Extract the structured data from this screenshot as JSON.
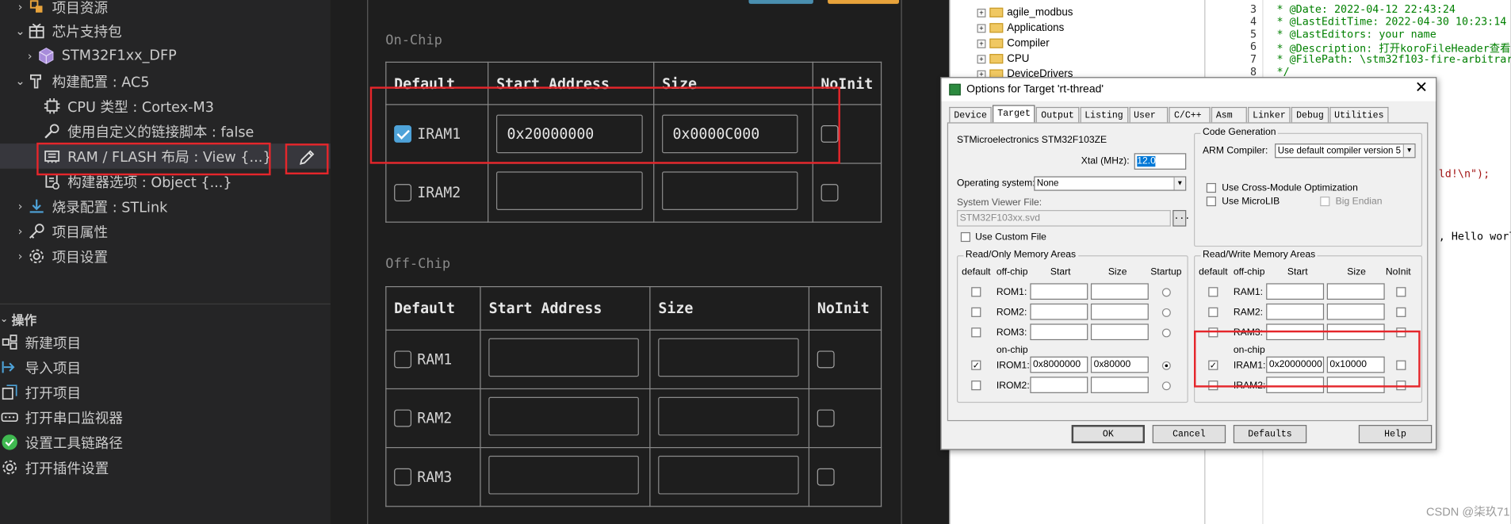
{
  "sidebar": {
    "tree": [
      {
        "label": "项目资源",
        "icon": "resource-icon",
        "chevron": "›"
      },
      {
        "label": "芯片支持包",
        "icon": "package-icon",
        "chevron": "⌄"
      },
      {
        "label": "STM32F1xx_DFP",
        "icon": "cube-icon",
        "chevron": "›"
      },
      {
        "label": "构建配置 : AC5",
        "icon": "hammer-icon",
        "chevron": "⌄"
      },
      {
        "label": "CPU 类型 : Cortex-M3",
        "icon": "cpu-icon",
        "chevron": ""
      },
      {
        "label": "使用自定义的链接脚本 : false",
        "icon": "wrench-icon",
        "chevron": ""
      },
      {
        "label": "RAM / FLASH 布局 : View {...}",
        "icon": "memory-icon",
        "chevron": ""
      },
      {
        "label": "构建器选项 : Object {...}",
        "icon": "builder-options-icon",
        "chevron": ""
      },
      {
        "label": "烧录配置 : STLink",
        "icon": "download-icon",
        "chevron": "›"
      },
      {
        "label": "项目属性",
        "icon": "key-icon",
        "chevron": "›"
      },
      {
        "label": "项目设置",
        "icon": "gear-icon",
        "chevron": "›"
      }
    ],
    "section_title": "操作",
    "actions": [
      {
        "label": "新建项目",
        "icon": "new-project-icon"
      },
      {
        "label": "导入项目",
        "icon": "import-icon"
      },
      {
        "label": "打开项目",
        "icon": "open-project-icon"
      },
      {
        "label": "打开串口监视器",
        "icon": "serial-icon"
      },
      {
        "label": "设置工具链路径",
        "icon": "check-circle-icon"
      },
      {
        "label": "打开插件设置",
        "icon": "plugin-gear-icon"
      }
    ]
  },
  "memview": {
    "on_chip_title": "On-Chip",
    "off_chip_title": "Off-Chip",
    "headers": [
      "Default",
      "Start Address",
      "Size",
      "NoInit"
    ],
    "on_chip_rows": [
      {
        "name": "IRAM1",
        "checked": true,
        "start": "0x20000000",
        "size": "0x0000C000"
      },
      {
        "name": "IRAM2",
        "checked": false,
        "start": "",
        "size": ""
      }
    ],
    "off_chip_rows": [
      {
        "name": "RAM1",
        "checked": false,
        "start": "",
        "size": ""
      },
      {
        "name": "RAM2",
        "checked": false,
        "start": "",
        "size": ""
      },
      {
        "name": "RAM3",
        "checked": false,
        "start": "",
        "size": ""
      }
    ]
  },
  "explorer": {
    "items": [
      "agile_modbus",
      "Applications",
      "Compiler",
      "CPU",
      "DeviceDrivers"
    ]
  },
  "editor": {
    "lines": [
      {
        "n": "3",
        "text": " * @Date: 2022-04-12 22:43:24",
        "kind": "cmt"
      },
      {
        "n": "4",
        "text": " * @LastEditTime: 2022-04-30 10:23:14",
        "kind": "cmt"
      },
      {
        "n": "5",
        "text": " * @LastEditors: your name",
        "kind": "cmt"
      },
      {
        "n": "6",
        "text": " * @Description: 打开koroFileHeader查看",
        "kind": "cmt"
      },
      {
        "n": "7",
        "text": " * @FilePath: \\stm32f103-fire-arbitrar",
        "kind": "cmt"
      },
      {
        "n": "8",
        "text": " */",
        "kind": "cmt"
      }
    ],
    "fragment1": "ld!\\n\");",
    "fragment2": ", Hello worl",
    "watermark": "CSDN @柒玖71"
  },
  "dialog": {
    "title": "Options for Target 'rt-thread'",
    "tabs": [
      "Device",
      "Target",
      "Output",
      "Listing",
      "User",
      "C/C++",
      "Asm",
      "Linker",
      "Debug",
      "Utilities"
    ],
    "active_tab": "Target",
    "device_name": "STMicroelectronics STM32F103ZE",
    "xtal_label": "Xtal (MHz):",
    "xtal_value": "12.0",
    "os_label": "Operating system:",
    "os_value": "None",
    "svf_label": "System Viewer File:",
    "svf_value": "STM32F103xx.svd",
    "custom_file": "Use Custom File",
    "codegen_title": "Code Generation",
    "arm_compiler_label": "ARM Compiler:",
    "arm_compiler_value": "Use default compiler version 5",
    "cross_module": "Use Cross-Module Optimization",
    "microlib": "Use MicroLIB",
    "big_endian": "Big Endian",
    "ro_title": "Read/Only Memory Areas",
    "rw_title": "Read/Write Memory Areas",
    "ro_headers": [
      "default",
      "off-chip",
      "Start",
      "Size",
      "Startup"
    ],
    "rw_headers": [
      "default",
      "off-chip",
      "Start",
      "Size",
      "NoInit"
    ],
    "on_chip_label": "on-chip",
    "ro_rows": [
      {
        "name": "ROM1:",
        "start": "",
        "size": "",
        "def": false,
        "startup": false
      },
      {
        "name": "ROM2:",
        "start": "",
        "size": "",
        "def": false,
        "startup": false
      },
      {
        "name": "ROM3:",
        "start": "",
        "size": "",
        "def": false,
        "startup": false
      },
      {
        "name": "IROM1:",
        "start": "0x8000000",
        "size": "0x80000",
        "def": true,
        "startup": true
      },
      {
        "name": "IROM2:",
        "start": "",
        "size": "",
        "def": false,
        "startup": false
      }
    ],
    "rw_rows": [
      {
        "name": "RAM1:",
        "start": "",
        "size": "",
        "def": false
      },
      {
        "name": "RAM2:",
        "start": "",
        "size": "",
        "def": false
      },
      {
        "name": "RAM3:",
        "start": "",
        "size": "",
        "def": false
      },
      {
        "name": "IRAM1:",
        "start": "0x20000000",
        "size": "0x10000",
        "def": true
      },
      {
        "name": "IRAM2:",
        "start": "",
        "size": "",
        "def": false
      }
    ],
    "buttons": {
      "ok": "OK",
      "cancel": "Cancel",
      "defaults": "Defaults",
      "help": "Help"
    },
    "check_mark": "✓",
    "ellipsis": "..."
  },
  "colors": {
    "highlight": "#e5262b",
    "checkbox_on": "#4ea3d9",
    "top_btn_left": "#4a8fb0",
    "top_btn_right": "#e8a33b"
  }
}
